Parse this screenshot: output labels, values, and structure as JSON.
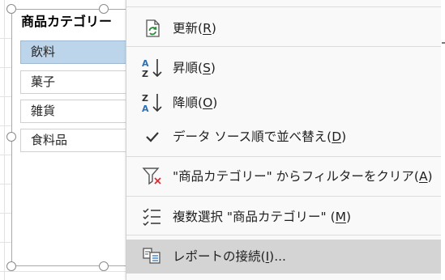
{
  "slicer": {
    "title": "商品カテゴリー",
    "items": [
      {
        "label": "飲料",
        "selected": true
      },
      {
        "label": "菓子",
        "selected": false
      },
      {
        "label": "雑貨",
        "selected": false
      },
      {
        "label": "食料品",
        "selected": false
      }
    ]
  },
  "context_menu": {
    "items": [
      {
        "id": "refresh",
        "label": "更新(",
        "key": "R",
        "suffix": ")",
        "icon": "refresh-icon"
      },
      {
        "id": "sort-asc",
        "label": "昇順(",
        "key": "S",
        "suffix": ")",
        "icon": "sort-ascending-icon"
      },
      {
        "id": "sort-desc",
        "label": "降順(",
        "key": "O",
        "suffix": ")",
        "icon": "sort-descending-icon"
      },
      {
        "id": "data-source-order",
        "label": "データ ソース順で並べ替え(",
        "key": "D",
        "suffix": ")",
        "icon": "checkmark-icon"
      },
      {
        "id": "clear-filter",
        "label": "\"商品カテゴリー\" からフィルターをクリア(",
        "key": "A",
        "suffix": ")",
        "icon": "clear-filter-icon"
      },
      {
        "id": "multi-select",
        "label": "複数選択 \"商品カテゴリー\" (",
        "key": "M",
        "suffix": ")",
        "icon": "multi-select-icon"
      },
      {
        "id": "report-connections",
        "label": "レポートの接続(",
        "key": "I",
        "suffix": ")...",
        "icon": "report-connections-icon",
        "highlighted": true
      }
    ]
  },
  "colors": {
    "selected_item": "#bdd5ea",
    "menu_background": "#f9f9f9",
    "menu_highlight": "#d4d4d4",
    "refresh_green": "#2e8b3a",
    "sort_blue": "#2f6fb5",
    "clear_red": "#d13438"
  }
}
